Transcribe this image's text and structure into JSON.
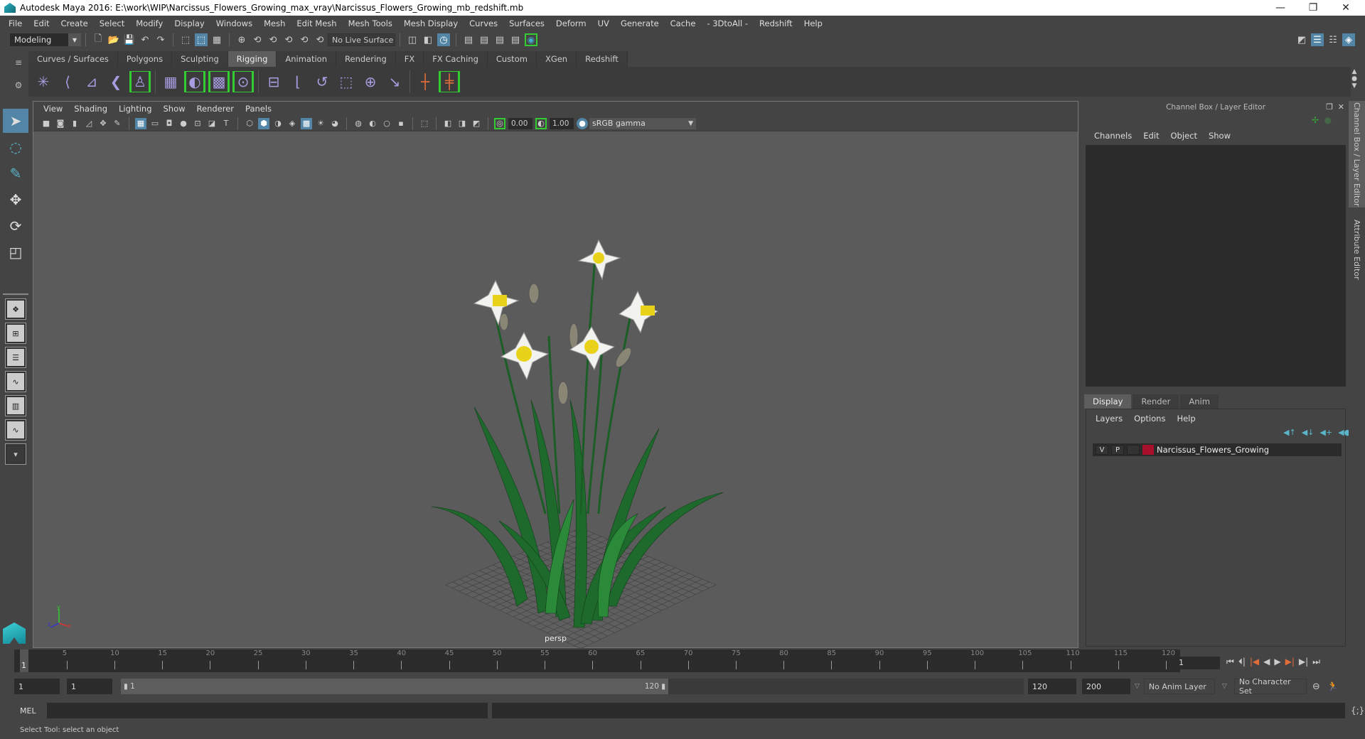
{
  "window": {
    "title": "Autodesk Maya 2016: E:\\work\\WIP\\Narcissus_Flowers_Growing_max_vray\\Narcissus_Flowers_Growing_mb_redshift.mb",
    "minimize": "—",
    "restore": "❐",
    "close": "✕"
  },
  "menubar": [
    "File",
    "Edit",
    "Create",
    "Select",
    "Modify",
    "Display",
    "Windows",
    "Mesh",
    "Edit Mesh",
    "Mesh Tools",
    "Mesh Display",
    "Curves",
    "Surfaces",
    "Deform",
    "UV",
    "Generate",
    "Cache",
    "- 3DtoAll -",
    "Redshift",
    "Help"
  ],
  "statusline": {
    "mode": "Modeling",
    "live_surface": "No Live Surface"
  },
  "shelf": {
    "tabs": [
      "Curves / Surfaces",
      "Polygons",
      "Sculpting",
      "Rigging",
      "Animation",
      "Rendering",
      "FX",
      "FX Caching",
      "Custom",
      "XGen",
      "Redshift"
    ],
    "active_tab": "Rigging"
  },
  "viewport": {
    "menu": [
      "View",
      "Shading",
      "Lighting",
      "Show",
      "Renderer",
      "Panels"
    ],
    "exposure": "0.00",
    "gamma": "1.00",
    "color_space": "sRGB gamma",
    "camera": "persp",
    "axis": {
      "x": "x",
      "y": "y",
      "z": "z"
    }
  },
  "channel_box": {
    "title": "Channel Box / Layer Editor",
    "menu": [
      "Channels",
      "Edit",
      "Object",
      "Show"
    ]
  },
  "layer_editor": {
    "tabs": [
      "Display",
      "Render",
      "Anim"
    ],
    "active_tab": "Display",
    "menu": [
      "Layers",
      "Options",
      "Help"
    ],
    "layers": [
      {
        "v": "V",
        "p": "P",
        "name": "Narcissus_Flowers_Growing",
        "color": "#a6102a"
      }
    ]
  },
  "side_tabs": [
    "Channel Box / Layer Editor",
    "Attribute Editor"
  ],
  "timeline": {
    "ticks": [
      5,
      10,
      15,
      20,
      25,
      30,
      35,
      40,
      45,
      50,
      55,
      60,
      65,
      70,
      75,
      80,
      85,
      90,
      95,
      100,
      105,
      110,
      115,
      120
    ],
    "start_label": "1",
    "current_frame": "1",
    "range_min": 1,
    "range_max": 120
  },
  "range": {
    "start": "1",
    "playback_start": "1",
    "slider_start": "1",
    "slider_end": "120",
    "playback_end": "120",
    "end": "200",
    "anim_layer": "No Anim Layer",
    "character_set": "No Character Set"
  },
  "command_line": {
    "label": "MEL",
    "value": ""
  },
  "status": {
    "help_line": "Select Tool: select an object"
  },
  "colors": {
    "accent": "#5285a6",
    "panel": "#444444",
    "viewport_bg": "#5b5b5b",
    "field": "#2b2b2b",
    "shelf_highlight": "#33cc33",
    "key_orange": "#e06c3a"
  }
}
